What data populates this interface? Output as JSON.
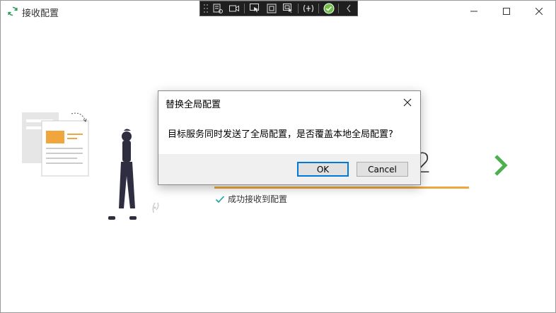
{
  "window": {
    "title": "接收配置"
  },
  "main": {
    "step_digit": "2",
    "status_text": "成功接收到配置"
  },
  "dialog": {
    "title": "替换全局配置",
    "message": "目标服务同时发送了全局配置，是否覆盖本地全局配置?",
    "ok_label": "OK",
    "cancel_label": "Cancel"
  },
  "icons": {
    "app": "refresh-icon",
    "next": "chevron-right-icon",
    "status": "check-icon"
  },
  "colors": {
    "accent_orange": "#f0a63c",
    "success_green": "#4caf50",
    "dialog_focus": "#0078d7",
    "devtools_bg": "#1f1f1f"
  }
}
